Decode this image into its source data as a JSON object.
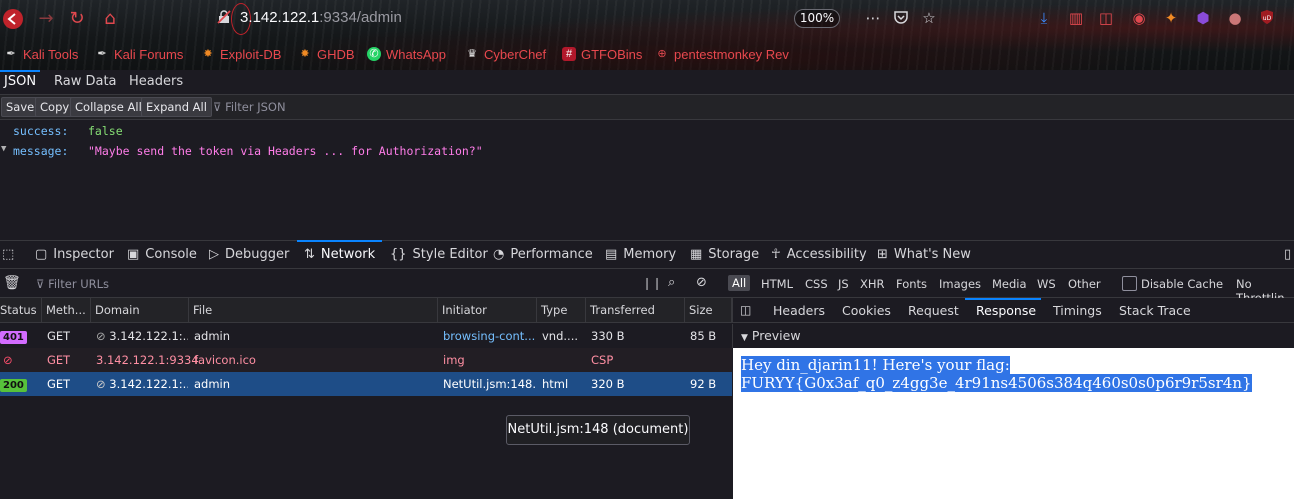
{
  "browser": {
    "url_host": "3.142.122.1",
    "url_rest": ":9334/admin",
    "zoom": "100%",
    "bookmarks": [
      {
        "label": "Kali Tools",
        "icon": "kali-dragon-icon"
      },
      {
        "label": "Kali Forums",
        "icon": "kali-dragon-icon"
      },
      {
        "label": "Exploit-DB",
        "icon": "exploitdb-icon"
      },
      {
        "label": "GHDB",
        "icon": "exploitdb-icon"
      },
      {
        "label": "WhatsApp",
        "icon": "whatsapp-icon"
      },
      {
        "label": "CyberChef",
        "icon": "chef-hat-icon"
      },
      {
        "label": "GTFOBins",
        "icon": "hash-icon"
      },
      {
        "label": "pentestmonkey Rev",
        "icon": "globe-icon"
      }
    ]
  },
  "json_viewer": {
    "tabs": [
      "JSON",
      "Raw Data",
      "Headers"
    ],
    "buttons": [
      "Save",
      "Copy",
      "Collapse All",
      "Expand All"
    ],
    "filter_placeholder": "Filter JSON",
    "rows": [
      {
        "key": "success:",
        "value": "false"
      },
      {
        "key": "message:",
        "value": "\"Maybe send the token via Headers ... for Authorization?\""
      }
    ]
  },
  "devtools": {
    "tabs": [
      "Inspector",
      "Console",
      "Debugger",
      "Network",
      "Style Editor",
      "Performance",
      "Memory",
      "Storage",
      "Accessibility",
      "What's New"
    ],
    "filter_urls_placeholder": "Filter URLs",
    "type_filters": [
      "All",
      "HTML",
      "CSS",
      "JS",
      "XHR",
      "Fonts",
      "Images",
      "Media",
      "WS",
      "Other"
    ],
    "disable_cache": "Disable Cache",
    "throttling": "No Throttlin",
    "columns": [
      "Status",
      "Meth...",
      "Domain",
      "File",
      "Initiator",
      "Type",
      "Transferred",
      "Size"
    ],
    "requests": [
      {
        "status": "401",
        "method": "GET",
        "domain": "3.142.122.1:...",
        "file": "admin",
        "initiator": "browsing-cont...",
        "type": "vnd....",
        "transferred": "330 B",
        "size": "85 B"
      },
      {
        "status": "",
        "method": "GET",
        "domain": "3.142.122.1:9334",
        "file": "favicon.ico",
        "initiator": "img",
        "type": "",
        "transferred": "CSP",
        "size": ""
      },
      {
        "status": "200",
        "method": "GET",
        "domain": "3.142.122.1:...",
        "file": "admin",
        "initiator": "NetUtil.jsm:148...",
        "type": "html",
        "transferred": "320 B",
        "size": "92 B"
      }
    ],
    "tooltip": "NetUtil.jsm:148 (document)",
    "detail_tabs": [
      "Headers",
      "Cookies",
      "Request",
      "Response",
      "Timings",
      "Stack Trace"
    ],
    "preview_label": "Preview",
    "response_line1": "Hey din_djarin11! Here's your flag:",
    "response_line2": "FURYY{G0x3af_q0_z4gg3e_4r91ns4506s384q460s0s0p6r9r5sr4n}"
  },
  "colors": {
    "accent": "#0a84ff",
    "status_401": "#d36cff",
    "status_200": "#57c23b",
    "blocked": "#ff4f6d",
    "json_key": "#75bfff",
    "json_string": "#ff7de9",
    "json_bool": "#86de74"
  }
}
